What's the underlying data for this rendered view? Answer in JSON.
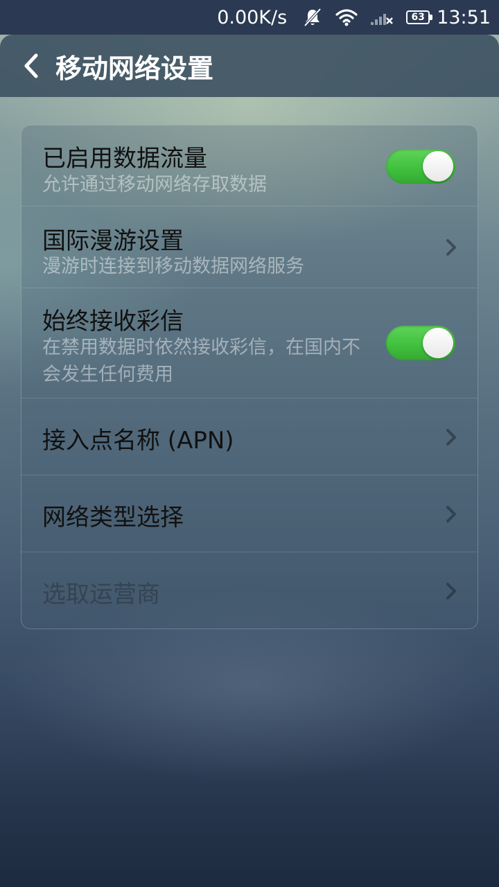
{
  "status_bar": {
    "net_speed": "0.00K/s",
    "battery_level": "63",
    "time": "13:51",
    "icons": [
      "notifications-muted-icon",
      "wifi-icon",
      "signal-no-service-icon",
      "battery-icon"
    ]
  },
  "header": {
    "title": "移动网络设置"
  },
  "settings": {
    "data_enabled": {
      "title": "已启用数据流量",
      "subtitle": "允许通过移动网络存取数据",
      "toggle_on": true
    },
    "roaming": {
      "title": "国际漫游设置",
      "subtitle": "漫游时连接到移动数据网络服务"
    },
    "mms": {
      "title": "始终接收彩信",
      "subtitle": "在禁用数据时依然接收彩信，在国内不会发生任何费用",
      "toggle_on": true
    },
    "apn": {
      "title": "接入点名称 (APN)"
    },
    "network_type": {
      "title": "网络类型选择"
    },
    "operator": {
      "title": "选取运营商",
      "enabled": false
    }
  },
  "colors": {
    "toggle_on": "#3fbf3c",
    "status_bar_bg": "#2b3a52"
  }
}
